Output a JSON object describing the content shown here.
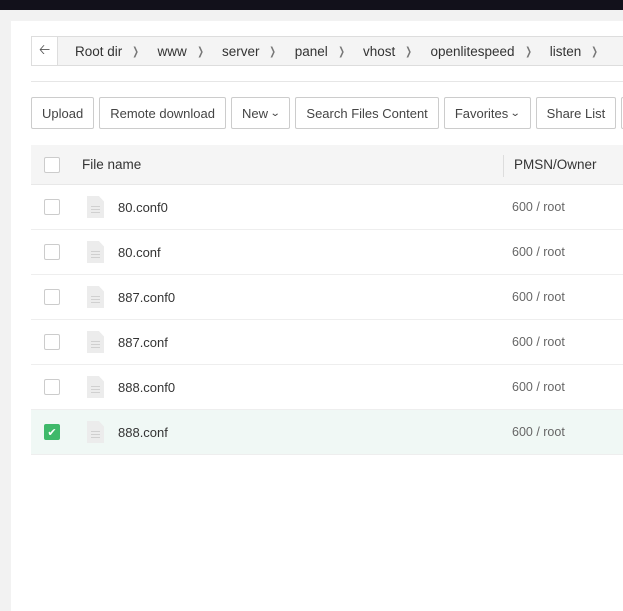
{
  "breadcrumb": [
    "Root dir",
    "www",
    "server",
    "panel",
    "vhost",
    "openlitespeed",
    "listen"
  ],
  "toolbar": {
    "upload": "Upload",
    "remote": "Remote download",
    "new": "New",
    "search": "Search Files Content",
    "favorites": "Favorites",
    "share": "Share List"
  },
  "table": {
    "col_name": "File name",
    "col_perm": "PMSN/Owner",
    "rows": [
      {
        "name": "80.conf0",
        "perm": "600 / root",
        "checked": false
      },
      {
        "name": "80.conf",
        "perm": "600 / root",
        "checked": false
      },
      {
        "name": "887.conf0",
        "perm": "600 / root",
        "checked": false
      },
      {
        "name": "887.conf",
        "perm": "600 / root",
        "checked": false
      },
      {
        "name": "888.conf0",
        "perm": "600 / root",
        "checked": false
      },
      {
        "name": "888.conf",
        "perm": "600 / root",
        "checked": true
      }
    ]
  },
  "colors": {
    "accent": "#3fb96a",
    "selected_row": "#f0f8f5"
  }
}
